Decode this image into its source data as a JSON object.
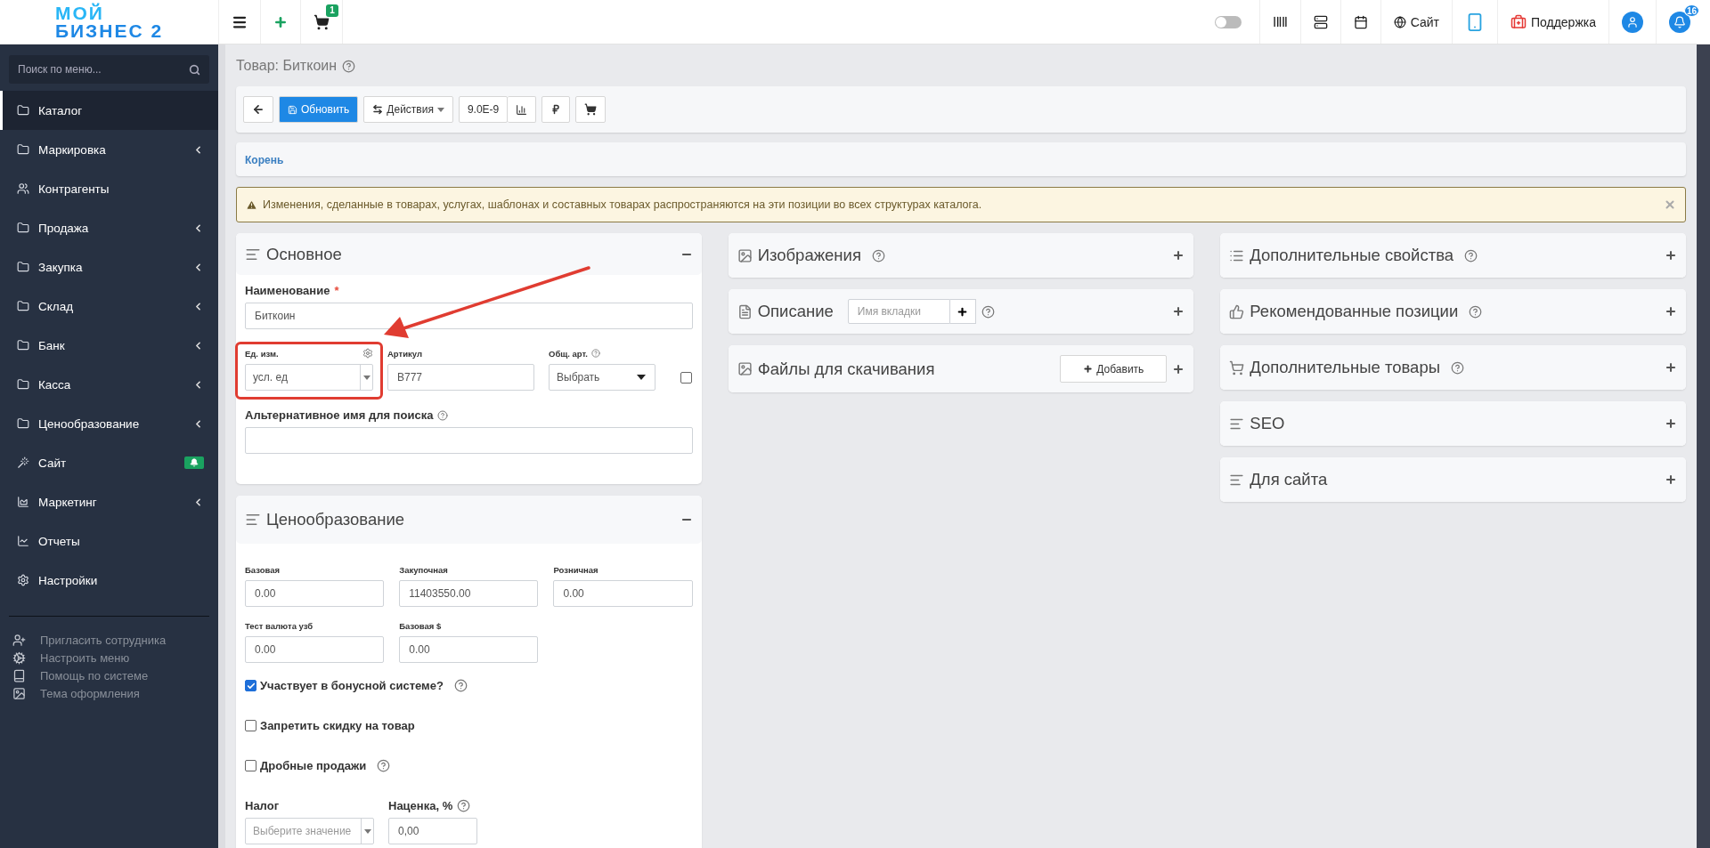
{
  "logo": {
    "line1": "МОЙ",
    "line2": "БИЗНЕС 2"
  },
  "topbar": {
    "cart_badge": "1",
    "dark_mode_on": false,
    "site_link": "Сайт",
    "support_link": "Поддержка",
    "notifications_badge": "16"
  },
  "sidebar": {
    "search_placeholder": "Поиск по меню...",
    "items": [
      {
        "label": "Каталог",
        "selected": true,
        "has_submenu": false,
        "badge": false
      },
      {
        "label": "Маркировка",
        "selected": false,
        "has_submenu": true,
        "badge": false
      },
      {
        "label": "Контрагенты",
        "selected": false,
        "has_submenu": false,
        "badge": false
      },
      {
        "label": "Продажа",
        "selected": false,
        "has_submenu": true,
        "badge": false
      },
      {
        "label": "Закупка",
        "selected": false,
        "has_submenu": true,
        "badge": false
      },
      {
        "label": "Склад",
        "selected": false,
        "has_submenu": true,
        "badge": false
      },
      {
        "label": "Банк",
        "selected": false,
        "has_submenu": true,
        "badge": false
      },
      {
        "label": "Касса",
        "selected": false,
        "has_submenu": true,
        "badge": false
      },
      {
        "label": "Ценообразование",
        "selected": false,
        "has_submenu": true,
        "badge": false
      },
      {
        "label": "Сайт",
        "selected": false,
        "has_submenu": false,
        "badge": true
      },
      {
        "label": "Маркетинг",
        "selected": false,
        "has_submenu": true,
        "badge": false
      },
      {
        "label": "Отчеты",
        "selected": false,
        "has_submenu": false,
        "badge": false
      },
      {
        "label": "Настройки",
        "selected": false,
        "has_submenu": false,
        "badge": false
      }
    ],
    "footer_links": [
      "Пригласить сотрудника",
      "Настроить меню",
      "Помощь по системе",
      "Тема оформления"
    ]
  },
  "page": {
    "title": "Товар: Биткоин",
    "toolbar": {
      "refresh": "Обновить",
      "actions": "Действия",
      "rate": "9.0E-9"
    },
    "breadcrumb": "Корень",
    "alert": "Изменения, сделанные в товарах, услугах, шаблонах и составных товарах распространяются на эти позиции во всех структурах каталога."
  },
  "main_panel": {
    "title": "Основное",
    "expanded": true,
    "name_label": "Наименование",
    "required_mark": "*",
    "name_value": "Биткоин",
    "unit_label": "Ед. изм.",
    "unit_value": "усл. ед",
    "unit_highlighted": true,
    "sku_label": "Артикул",
    "sku_value": "B777",
    "common_sku_label": "Общ. арт.",
    "common_sku_value": "Выбрать",
    "common_sku_checked": false,
    "alt_name_label": "Альтернативное имя для поиска"
  },
  "pricing_panel": {
    "title": "Ценообразование",
    "expanded": true,
    "prices": [
      {
        "label": "Базовая",
        "value": "0.00"
      },
      {
        "label": "Закупочная",
        "value": "11403550.00"
      },
      {
        "label": "Розничная",
        "value": "0.00"
      },
      {
        "label": "Тест валюта узб",
        "value": "0.00"
      },
      {
        "label": "Базовая $",
        "value": "0.00"
      }
    ],
    "checkboxes": [
      {
        "label": "Участвует в бонусной системе?",
        "checked": true,
        "help": true
      },
      {
        "label": "Запретить скидку на товар",
        "checked": false,
        "help": false
      },
      {
        "label": "Дробные продажи",
        "checked": false,
        "help": true
      }
    ],
    "tax_label": "Налог",
    "tax_placeholder": "Выберите значение",
    "markup_label": "Наценка, %",
    "markup_value": "0,00"
  },
  "middle_panels": [
    {
      "title": "Изображения",
      "kind": "help",
      "expanded": false
    },
    {
      "title": "Описание",
      "kind": "tab-input",
      "placeholder": "Имя вкладки",
      "expanded": false
    },
    {
      "title": "Файлы для скачивания",
      "kind": "add-button",
      "button": "Добавить",
      "expanded": false
    }
  ],
  "right_panels": [
    {
      "title": "Дополнительные свойства",
      "help": true,
      "expanded": false
    },
    {
      "title": "Рекомендованные позиции",
      "help": true,
      "expanded": false
    },
    {
      "title": "Дополнительные товары",
      "help": true,
      "expanded": false
    },
    {
      "title": "SEO",
      "help": false,
      "expanded": false
    },
    {
      "title": "Для сайта",
      "help": false,
      "expanded": false
    }
  ]
}
